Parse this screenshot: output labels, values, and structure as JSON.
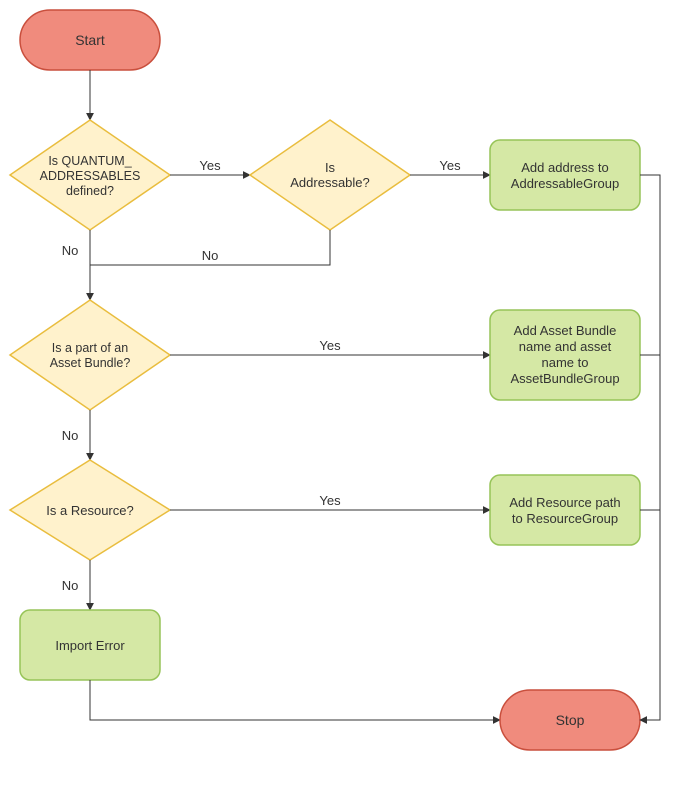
{
  "nodes": {
    "start": "Start",
    "stop": "Stop",
    "quantum_defined": {
      "line1": "Is QUANTUM_",
      "line2": "ADDRESSABLES",
      "line3": "defined?"
    },
    "is_addressable": {
      "line1": "Is",
      "line2": "Addressable?"
    },
    "add_addressable": {
      "line1": "Add address to",
      "line2": "AddressableGroup"
    },
    "asset_bundle": {
      "line1": "Is a part of an",
      "line2": "Asset Bundle?"
    },
    "add_bundle": {
      "line1": "Add Asset Bundle",
      "line2": "name and asset",
      "line3": "name to",
      "line4": "AssetBundleGroup"
    },
    "is_resource": "Is a Resource?",
    "add_resource": {
      "line1": "Add Resource path",
      "line2": "to ResourceGroup"
    },
    "import_error": "Import Error"
  },
  "labels": {
    "yes": "Yes",
    "no": "No"
  },
  "colors": {
    "terminal_fill": "#f08b7d",
    "terminal_stroke": "#c94f3d",
    "decision_fill": "#fff2cc",
    "decision_stroke": "#e9bd3e",
    "process_fill": "#d5e8a5",
    "process_stroke": "#97c458",
    "edge": "#333333",
    "text": "#333333"
  },
  "chart_data": {
    "type": "flowchart",
    "nodes": [
      {
        "id": "start",
        "kind": "terminal",
        "label": "Start"
      },
      {
        "id": "q_defined",
        "kind": "decision",
        "label": "Is QUANTUM_ADDRESSABLES defined?"
      },
      {
        "id": "is_addr",
        "kind": "decision",
        "label": "Is Addressable?"
      },
      {
        "id": "add_addr",
        "kind": "process",
        "label": "Add address to AddressableGroup"
      },
      {
        "id": "is_ab",
        "kind": "decision",
        "label": "Is a part of an Asset Bundle?"
      },
      {
        "id": "add_ab",
        "kind": "process",
        "label": "Add Asset Bundle name and asset name to AssetBundleGroup"
      },
      {
        "id": "is_res",
        "kind": "decision",
        "label": "Is a Resource?"
      },
      {
        "id": "add_res",
        "kind": "process",
        "label": "Add Resource path to ResourceGroup"
      },
      {
        "id": "imp_err",
        "kind": "process",
        "label": "Import Error"
      },
      {
        "id": "stop",
        "kind": "terminal",
        "label": "Stop"
      }
    ],
    "edges": [
      {
        "from": "start",
        "to": "q_defined",
        "label": null
      },
      {
        "from": "q_defined",
        "to": "is_addr",
        "label": "Yes"
      },
      {
        "from": "q_defined",
        "to": "is_ab",
        "label": "No"
      },
      {
        "from": "is_addr",
        "to": "add_addr",
        "label": "Yes"
      },
      {
        "from": "is_addr",
        "to": "is_ab",
        "label": "No"
      },
      {
        "from": "is_ab",
        "to": "add_ab",
        "label": "Yes"
      },
      {
        "from": "is_ab",
        "to": "is_res",
        "label": "No"
      },
      {
        "from": "is_res",
        "to": "add_res",
        "label": "Yes"
      },
      {
        "from": "is_res",
        "to": "imp_err",
        "label": "No"
      },
      {
        "from": "add_addr",
        "to": "stop",
        "label": null
      },
      {
        "from": "add_ab",
        "to": "stop",
        "label": null
      },
      {
        "from": "add_res",
        "to": "stop",
        "label": null
      },
      {
        "from": "imp_err",
        "to": "stop",
        "label": null
      }
    ]
  }
}
